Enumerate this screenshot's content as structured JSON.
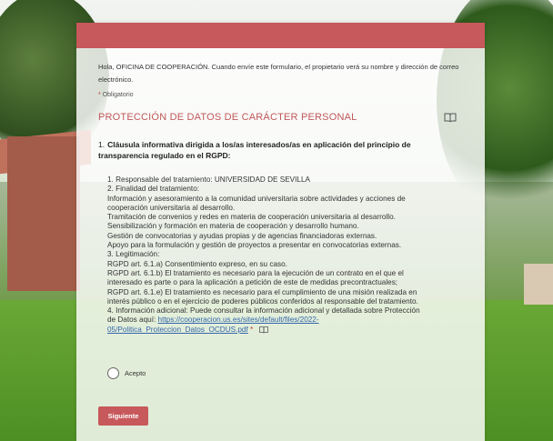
{
  "form": {
    "intro": "Hola, OFICINA DE COOPERACIÓN. Cuando envíe este formulario, el propietario verá su nombre y dirección de correo electrónico.",
    "required_star": "*",
    "required_label": "Obligatorio",
    "section_title": "PROTECCIÓN DE DATOS DE CARÁCTER PERSONAL",
    "section_icon": "immersive-reader-icon"
  },
  "question": {
    "number": "1.",
    "title": "Cláusula informativa dirigida a los/as interesados/as en aplicación del principio de transparencia regulado en el RGPD:",
    "lines": [
      "1. Responsable del tratamiento: UNIVERSIDAD DE SEVILLA",
      " 2. Finalidad del tratamiento:",
      " Información y asesoramiento a la comunidad universitaria sobre actividades y acciones de",
      "cooperación universitaria al desarrollo.",
      " Tramitación de convenios y redes en materia de cooperación universitaria al desarrollo.",
      " Sensibilización y formación en materia de cooperación y desarrollo humano.",
      " Gestión de convocatorias y ayudas propias y de agencias financiadoras externas.",
      " Apoyo para la formulación y gestión de proyectos a presentar en convocatorias externas.",
      " 3. Legitimación:",
      " RGPD art. 6.1.a) Consentimiento expreso, en su caso.",
      " RGPD art. 6.1.b) El tratamiento es necesario para la ejecución de un contrato en el que el",
      "interesado es parte o para la aplicación a petición de este de medidas precontractuales;",
      " RGPD art. 6.1.e) El tratamiento es necesario para el cumplimiento de una misión realizada en",
      "interés público o en el ejercicio de poderes públicos conferidos al responsable del tratamiento.",
      " 4. Información adicional: Puede consultar la información adicional y detallada sobre Protección",
      "de Datos aquí:"
    ],
    "link_part1": "https://cooperacion.us.es/sites/default/files/2022-",
    "link_part2": "05/Politica_Proteccion_Datos_OCDUS.pdf",
    "required_star": "*",
    "option_label": "Acepto"
  },
  "buttons": {
    "next_label": "Siguiente"
  },
  "colors": {
    "accent": "#c7585b",
    "link": "#3366aa"
  }
}
